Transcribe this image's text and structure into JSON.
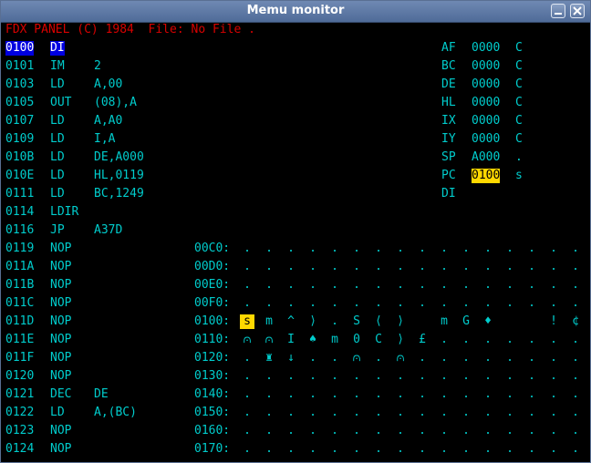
{
  "window": {
    "title": "Memu monitor"
  },
  "header": "FDX PANEL (C) 1984  File: No File .",
  "colors": {
    "text": "#00cccc",
    "header": "#d80000",
    "highlight_blue": "#0000e0",
    "highlight_yellow": "#ffd800",
    "background": "#000000"
  },
  "disassembly": [
    {
      "addr": "0100",
      "mnemonic": "DI",
      "operand": ""
    },
    {
      "addr": "0101",
      "mnemonic": "IM",
      "operand": "2"
    },
    {
      "addr": "0103",
      "mnemonic": "LD",
      "operand": "A,00"
    },
    {
      "addr": "0105",
      "mnemonic": "OUT",
      "operand": "(08),A"
    },
    {
      "addr": "0107",
      "mnemonic": "LD",
      "operand": "A,A0"
    },
    {
      "addr": "0109",
      "mnemonic": "LD",
      "operand": "I,A"
    },
    {
      "addr": "010B",
      "mnemonic": "LD",
      "operand": "DE,A000"
    },
    {
      "addr": "010E",
      "mnemonic": "LD",
      "operand": "HL,0119"
    },
    {
      "addr": "0111",
      "mnemonic": "LD",
      "operand": "BC,1249"
    },
    {
      "addr": "0114",
      "mnemonic": "LDIR",
      "operand": ""
    },
    {
      "addr": "0116",
      "mnemonic": "JP",
      "operand": "A37D"
    },
    {
      "addr": "0119",
      "mnemonic": "NOP",
      "operand": ""
    },
    {
      "addr": "011A",
      "mnemonic": "NOP",
      "operand": ""
    },
    {
      "addr": "011B",
      "mnemonic": "NOP",
      "operand": ""
    },
    {
      "addr": "011C",
      "mnemonic": "NOP",
      "operand": ""
    },
    {
      "addr": "011D",
      "mnemonic": "NOP",
      "operand": ""
    },
    {
      "addr": "011E",
      "mnemonic": "NOP",
      "operand": ""
    },
    {
      "addr": "011F",
      "mnemonic": "NOP",
      "operand": ""
    },
    {
      "addr": "0120",
      "mnemonic": "NOP",
      "operand": ""
    },
    {
      "addr": "0121",
      "mnemonic": "DEC",
      "operand": "DE"
    },
    {
      "addr": "0122",
      "mnemonic": "LD",
      "operand": "A,(BC)"
    },
    {
      "addr": "0123",
      "mnemonic": "NOP",
      "operand": ""
    },
    {
      "addr": "0124",
      "mnemonic": "NOP",
      "operand": ""
    }
  ],
  "registers": [
    {
      "name": "AF",
      "value": "0000",
      "flag": "C"
    },
    {
      "name": "BC",
      "value": "0000",
      "flag": "C"
    },
    {
      "name": "DE",
      "value": "0000",
      "flag": "C"
    },
    {
      "name": "HL",
      "value": "0000",
      "flag": "C"
    },
    {
      "name": "IX",
      "value": "0000",
      "flag": "C"
    },
    {
      "name": "IY",
      "value": "0000",
      "flag": "C"
    },
    {
      "name": "SP",
      "value": "A000",
      "flag": "."
    },
    {
      "name": "PC",
      "value": "0100",
      "flag": "s"
    },
    {
      "name": "DI",
      "value": "",
      "flag": ""
    }
  ],
  "memory": [
    {
      "addr": "00C0:",
      "cells": [
        ".",
        ".",
        ".",
        ".",
        ".",
        ".",
        ".",
        ".",
        ".",
        ".",
        ".",
        ".",
        ".",
        ".",
        ".",
        "."
      ]
    },
    {
      "addr": "00D0:",
      "cells": [
        ".",
        ".",
        ".",
        ".",
        ".",
        ".",
        ".",
        ".",
        ".",
        ".",
        ".",
        ".",
        ".",
        ".",
        ".",
        "."
      ]
    },
    {
      "addr": "00E0:",
      "cells": [
        ".",
        ".",
        ".",
        ".",
        ".",
        ".",
        ".",
        ".",
        ".",
        ".",
        ".",
        ".",
        ".",
        ".",
        ".",
        "."
      ]
    },
    {
      "addr": "00F0:",
      "cells": [
        ".",
        ".",
        ".",
        ".",
        ".",
        ".",
        ".",
        ".",
        ".",
        ".",
        ".",
        ".",
        ".",
        ".",
        ".",
        "."
      ]
    },
    {
      "addr": "0100:",
      "cells": [
        "s",
        "m",
        "^",
        "⟩",
        ".",
        "S",
        "⟨",
        "⟩",
        " ",
        "m",
        "G",
        "♦",
        " ",
        " ",
        "!",
        "¢"
      ]
    },
    {
      "addr": "0110:",
      "cells": [
        "⩀",
        "⩀",
        "I",
        "♠",
        "m",
        "0",
        "C",
        "⟩",
        "£",
        ".",
        ".",
        ".",
        ".",
        ".",
        ".",
        "."
      ]
    },
    {
      "addr": "0120:",
      "cells": [
        ".",
        "♜",
        "↓",
        ".",
        ".",
        "⩀",
        ".",
        "⩀",
        ".",
        ".",
        ".",
        ".",
        ".",
        ".",
        ".",
        "."
      ]
    },
    {
      "addr": "0130:",
      "cells": [
        ".",
        ".",
        ".",
        ".",
        ".",
        ".",
        ".",
        ".",
        ".",
        ".",
        ".",
        ".",
        ".",
        ".",
        ".",
        "."
      ]
    },
    {
      "addr": "0140:",
      "cells": [
        ".",
        ".",
        ".",
        ".",
        ".",
        ".",
        ".",
        ".",
        ".",
        ".",
        ".",
        ".",
        ".",
        ".",
        ".",
        "."
      ]
    },
    {
      "addr": "0150:",
      "cells": [
        ".",
        ".",
        ".",
        ".",
        ".",
        ".",
        ".",
        ".",
        ".",
        ".",
        ".",
        ".",
        ".",
        ".",
        ".",
        "."
      ]
    },
    {
      "addr": "0160:",
      "cells": [
        ".",
        ".",
        ".",
        ".",
        ".",
        ".",
        ".",
        ".",
        ".",
        ".",
        ".",
        ".",
        ".",
        ".",
        ".",
        "."
      ]
    },
    {
      "addr": "0170:",
      "cells": [
        ".",
        ".",
        ".",
        ".",
        ".",
        ".",
        ".",
        ".",
        ".",
        ".",
        ".",
        ".",
        ".",
        ".",
        ".",
        "."
      ]
    }
  ]
}
